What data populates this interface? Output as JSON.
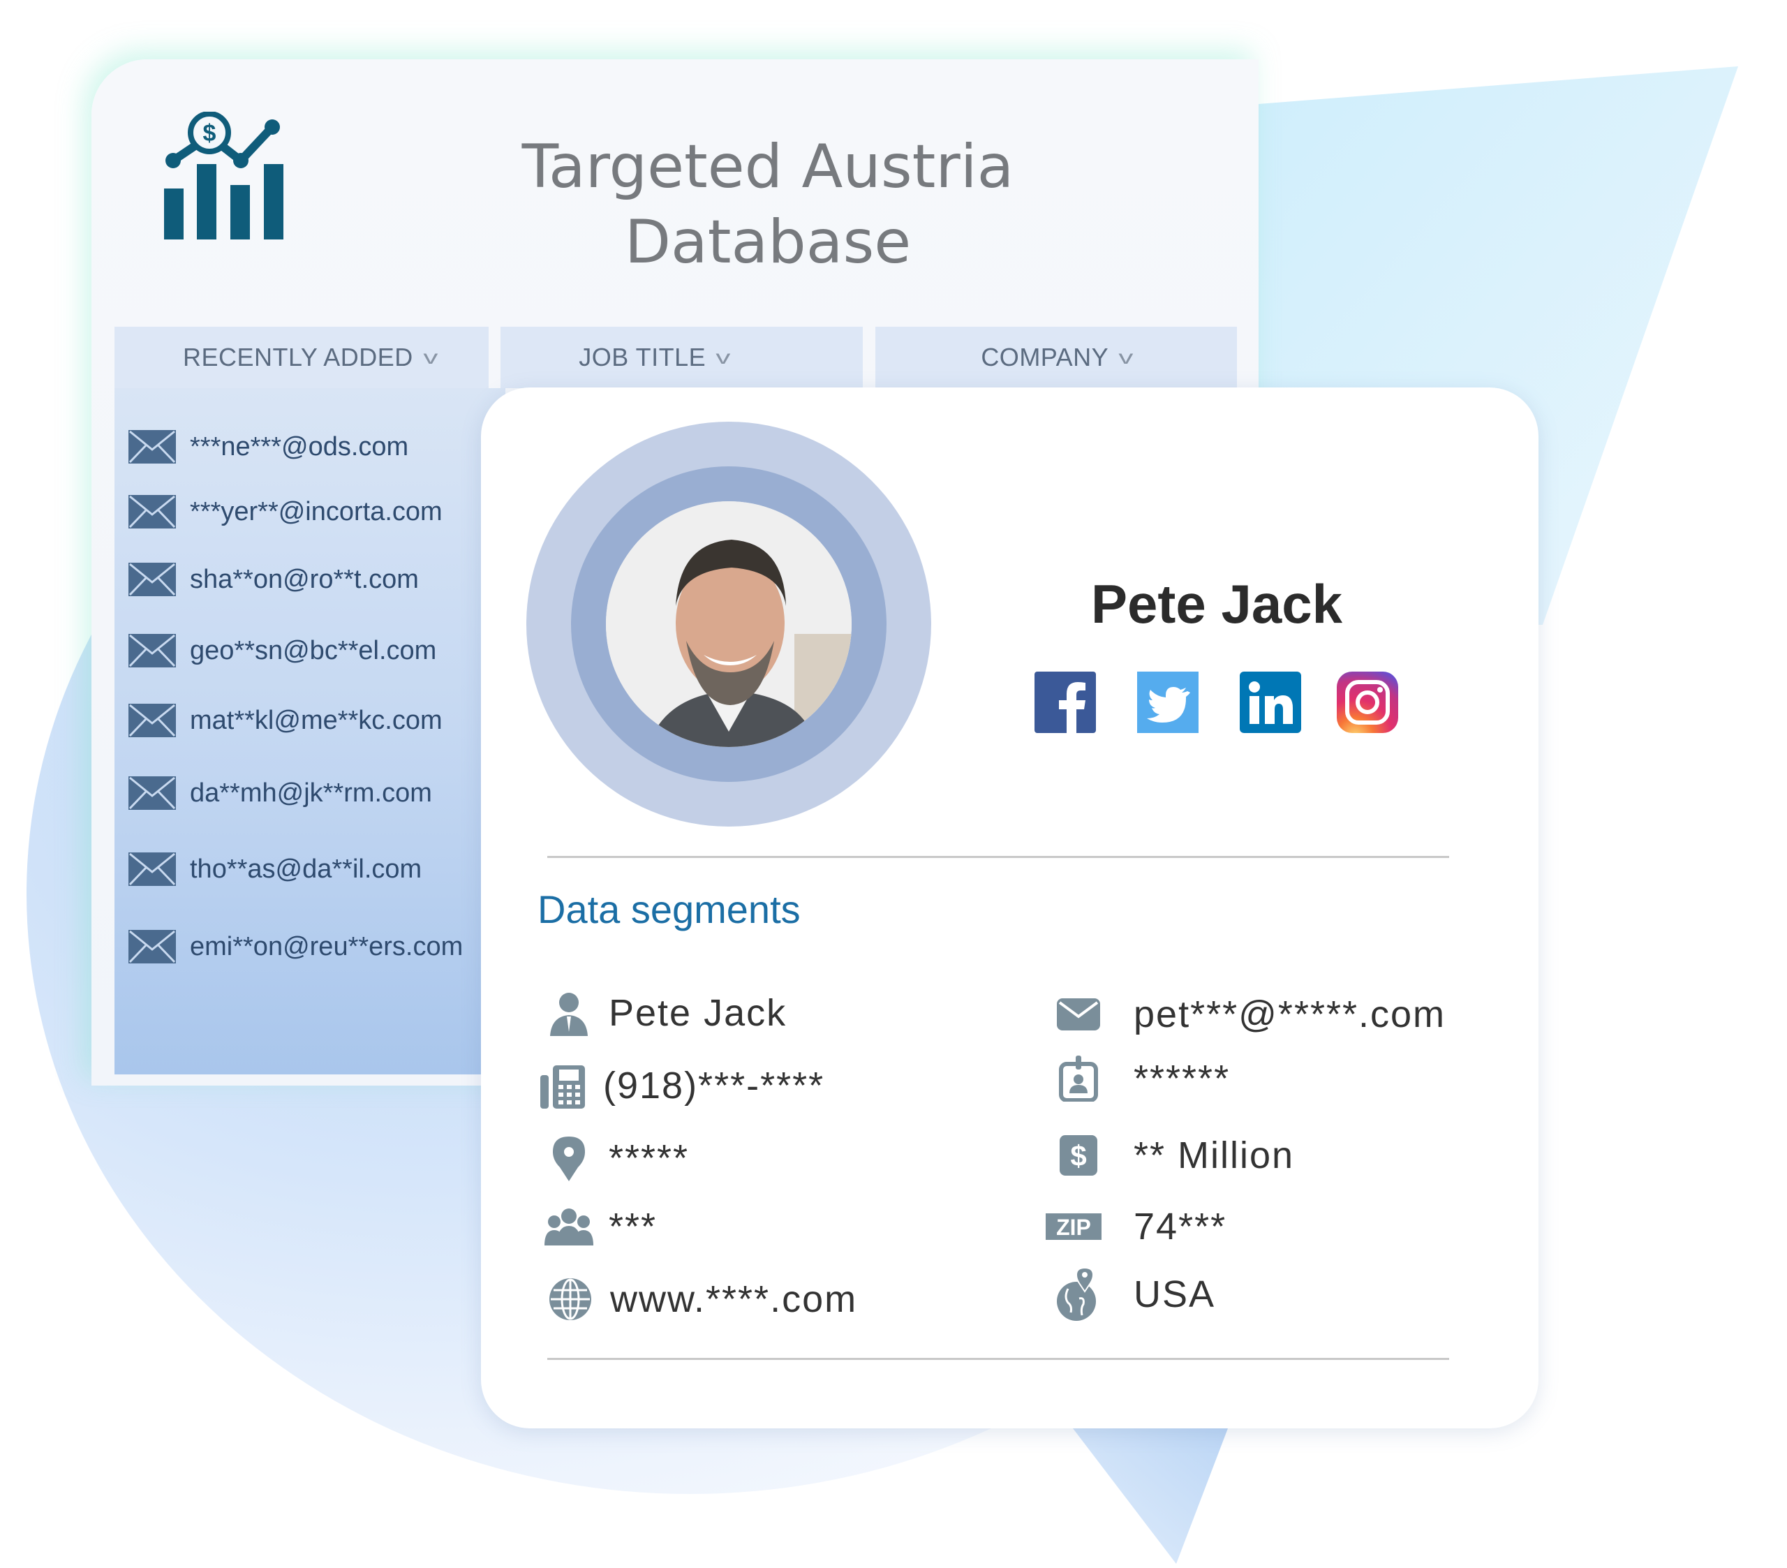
{
  "header": {
    "title_line1": "Targeted Austria",
    "title_line2": "Database",
    "logo_icon": "chart-dollar-icon"
  },
  "tabs": [
    {
      "label": "RECENTLY ADDED",
      "icon": "chevron-down-icon"
    },
    {
      "label": "JOB TITLE",
      "icon": "chevron-down-icon"
    },
    {
      "label": "COMPANY",
      "icon": "chevron-down-icon"
    }
  ],
  "chevron": "v",
  "emails": [
    "***ne***@ods.com",
    "***yer**@incorta.com",
    "sha**on@ro**t.com",
    "geo**sn@bc**el.com",
    "mat**kl@me**kc.com",
    "da**mh@jk**rm.com",
    "tho**as@da**il.com",
    "emi**on@reu**ers.com"
  ],
  "profile": {
    "name": "Pete Jack",
    "social": [
      {
        "name": "facebook",
        "color": "#3b5998"
      },
      {
        "name": "twitter",
        "color": "#55acee"
      },
      {
        "name": "linkedin",
        "color": "#0077b5"
      },
      {
        "name": "instagram",
        "color": "#c13584"
      }
    ]
  },
  "segments": {
    "title": "Data segments",
    "left": [
      {
        "icon": "person-icon",
        "value": "Pete Jack"
      },
      {
        "icon": "phone-icon",
        "value": "(918)***-****"
      },
      {
        "icon": "location-pin-icon",
        "value": "*****"
      },
      {
        "icon": "employees-icon",
        "value": "***"
      },
      {
        "icon": "globe-icon",
        "value": "www.****.com"
      }
    ],
    "right": [
      {
        "icon": "email-icon",
        "value": "pet***@*****.com"
      },
      {
        "icon": "id-badge-icon",
        "value": "******"
      },
      {
        "icon": "dollar-icon",
        "value": "** Million"
      },
      {
        "icon": "zip-icon",
        "value": "74***",
        "icon_text": "ZIP"
      },
      {
        "icon": "globe-pin-icon",
        "value": "USA"
      }
    ]
  },
  "colors": {
    "accent": "#1b6ea5",
    "logo": "#0f5c7a",
    "icon_gray": "#7a8e9a",
    "email_icon": "#4a6a8e"
  }
}
